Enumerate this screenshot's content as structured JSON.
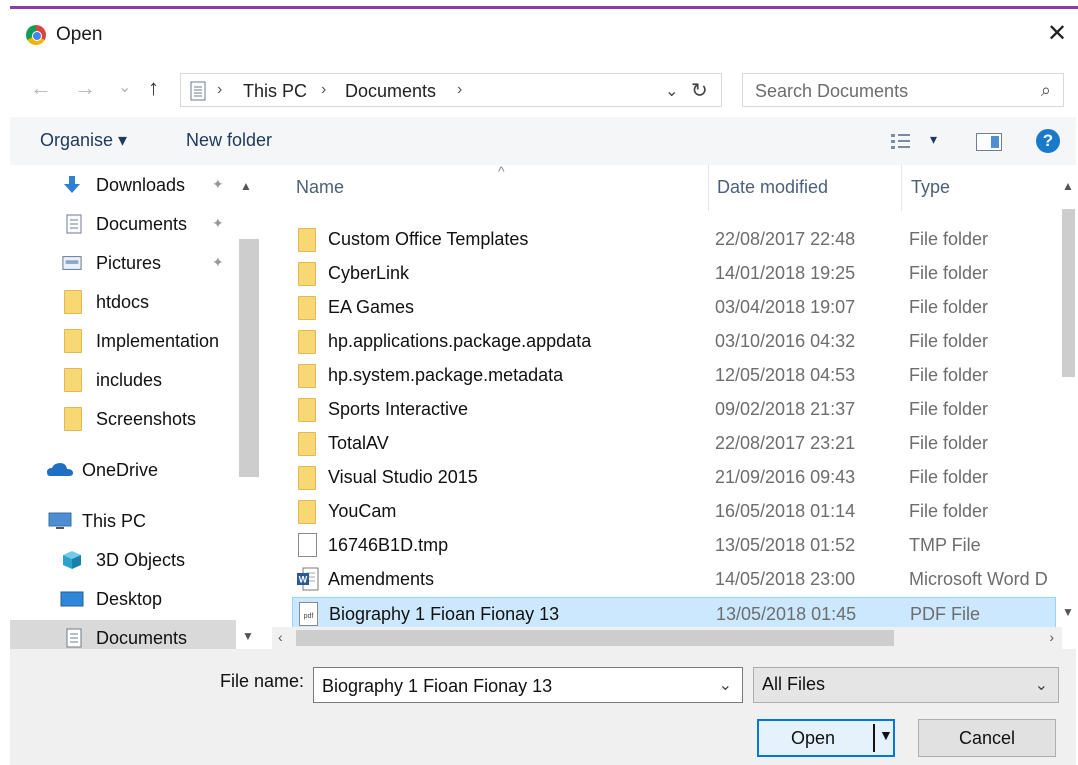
{
  "window": {
    "title": "Open",
    "close_glyph": "✕"
  },
  "nav": {
    "back_glyph": "←",
    "forward_glyph": "→",
    "recent_glyph": "⌄",
    "up_glyph": "↑",
    "breadcrumbs": [
      "This PC",
      "Documents"
    ],
    "crumb_sep": "›",
    "dropdown_glyph": "⌄",
    "refresh_glyph": "↻",
    "search_placeholder": "Search Documents",
    "search_icon_glyph": "⌕"
  },
  "toolbar": {
    "organise_label": "Organise ▾",
    "new_folder_label": "New folder",
    "view_dd_glyph": "▾",
    "help_label": "?"
  },
  "sidebar": {
    "items": [
      {
        "label": "Downloads",
        "pinned": true,
        "icon": "download-icon"
      },
      {
        "label": "Documents",
        "pinned": true,
        "icon": "documents-icon"
      },
      {
        "label": "Pictures",
        "pinned": true,
        "icon": "pictures-icon"
      },
      {
        "label": "htdocs",
        "icon": "folder-icon"
      },
      {
        "label": "Implementation",
        "icon": "folder-icon"
      },
      {
        "label": "includes",
        "icon": "folder-icon"
      },
      {
        "label": "Screenshots",
        "icon": "folder-icon"
      },
      {
        "label": "OneDrive",
        "icon": "onedrive-icon"
      },
      {
        "label": "This PC",
        "icon": "this-pc-icon"
      },
      {
        "label": "3D Objects",
        "icon": "3d-objects-icon"
      },
      {
        "label": "Desktop",
        "icon": "desktop-icon"
      },
      {
        "label": "Documents",
        "icon": "documents-icon",
        "selected": true
      }
    ],
    "pin_glyph": "📌"
  },
  "columns": {
    "name": "Name",
    "date": "Date modified",
    "type": "Type"
  },
  "files": [
    {
      "name": "Custom Office Templates",
      "date": "22/08/2017 22:48",
      "type": "File folder",
      "kind": "folder"
    },
    {
      "name": "CyberLink",
      "date": "14/01/2018 19:25",
      "type": "File folder",
      "kind": "folder"
    },
    {
      "name": "EA Games",
      "date": "03/04/2018 19:07",
      "type": "File folder",
      "kind": "folder"
    },
    {
      "name": "hp.applications.package.appdata",
      "date": "03/10/2016 04:32",
      "type": "File folder",
      "kind": "folder"
    },
    {
      "name": "hp.system.package.metadata",
      "date": "12/05/2018 04:53",
      "type": "File folder",
      "kind": "folder"
    },
    {
      "name": "Sports Interactive",
      "date": "09/02/2018 21:37",
      "type": "File folder",
      "kind": "folder"
    },
    {
      "name": "TotalAV",
      "date": "22/08/2017 23:21",
      "type": "File folder",
      "kind": "folder"
    },
    {
      "name": "Visual Studio 2015",
      "date": "21/09/2016 09:43",
      "type": "File folder",
      "kind": "folder"
    },
    {
      "name": "YouCam",
      "date": "16/05/2018 01:14",
      "type": "File folder",
      "kind": "folder"
    },
    {
      "name": "16746B1D.tmp",
      "date": "13/05/2018 01:52",
      "type": "TMP File",
      "kind": "file"
    },
    {
      "name": "Amendments",
      "date": "14/05/2018 23:00",
      "type": "Microsoft Word D",
      "kind": "word"
    },
    {
      "name": "Biography 1 Fioan Fionay 13",
      "date": "13/05/2018 01:45",
      "type": "PDF File",
      "kind": "pdf",
      "selected": true
    }
  ],
  "footer": {
    "file_name_label": "File name:",
    "file_name_value": "Biography 1 Fioan Fionay 13",
    "file_type_value": "All Files",
    "open_label": "Open",
    "cancel_label": "Cancel",
    "dd_glyph": "⌄"
  },
  "colors": {
    "accent": "#0078d7",
    "selection": "#cce8ff",
    "folder": "#f8d775",
    "title_line": "#8b3fa6"
  }
}
